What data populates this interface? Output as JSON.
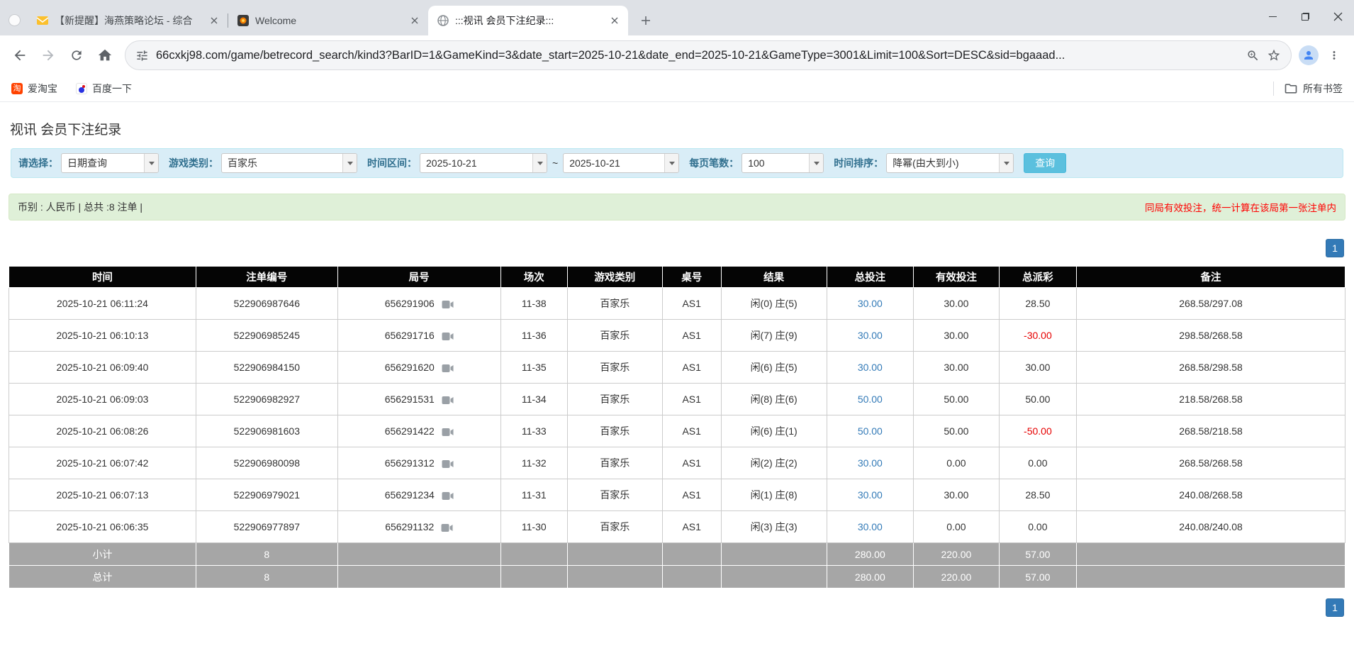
{
  "colors": {
    "table_header_bg": "#000000",
    "link_blue": "#337ab7",
    "negative_red": "#e60000",
    "result_red": "#e60000",
    "filter_bar_bg": "#d9edf7",
    "summary_bar_bg": "#dff0d8",
    "search_button_bg": "#5bc0de",
    "pagination_bg": "#337ab7",
    "footer_row_bg": "#a6a6a6"
  },
  "browser": {
    "tabs": [
      {
        "title": "【新提醒】海燕策略论坛 - 综合"
      },
      {
        "title": "Welcome"
      },
      {
        "title": ":::视讯 会员下注纪录:::"
      }
    ],
    "url": "66cxkj98.com/game/betrecord_search/kind3?BarID=1&GameKind=3&date_start=2025-10-21&date_end=2025-10-21&GameType=3001&Limit=100&Sort=DESC&sid=bgaaad...",
    "bookmarks": {
      "taobao": "爱淘宝",
      "taobao_icon_glyph": "淘",
      "baidu": "百度一下",
      "all_bookmarks": "所有书签"
    }
  },
  "page": {
    "title": "视讯 会员下注纪录",
    "filters": {
      "select_label": "请选择：",
      "select_value": "日期查询",
      "game_label": "游戏类别：",
      "game_value": "百家乐",
      "range_label": "时间区间：",
      "date_start": "2025-10-21",
      "tilde": "~",
      "date_end": "2025-10-21",
      "per_page_label": "每页笔数：",
      "per_page_value": "100",
      "sort_label": "时间排序：",
      "sort_value": "降幂(由大到小)",
      "search_button": "查询"
    },
    "summary": {
      "left": "币别 : 人民币 | 总共 :8 注单 |",
      "note": "同局有效投注，统一计算在该局第一张注单内"
    },
    "pagination": {
      "page": "1"
    },
    "table": {
      "headers": [
        "时间",
        "注单编号",
        "局号",
        "场次",
        "游戏类别",
        "桌号",
        "结果",
        "总投注",
        "有效投注",
        "总派彩",
        "备注"
      ],
      "rows": [
        {
          "time": "2025-10-21 06:11:24",
          "bet_id": "522906987646",
          "round": "656291906",
          "session": "11-38",
          "game": "百家乐",
          "table_no": "AS1",
          "result": "闲(0) 庄(5)",
          "total_bet": "30.00",
          "valid_bet": "30.00",
          "payout": "28.50",
          "note": "268.58/297.08"
        },
        {
          "time": "2025-10-21 06:10:13",
          "bet_id": "522906985245",
          "round": "656291716",
          "session": "11-36",
          "game": "百家乐",
          "table_no": "AS1",
          "result": "闲(7) 庄(9)",
          "total_bet": "30.00",
          "valid_bet": "30.00",
          "payout": "-30.00",
          "note": "298.58/268.58"
        },
        {
          "time": "2025-10-21 06:09:40",
          "bet_id": "522906984150",
          "round": "656291620",
          "session": "11-35",
          "game": "百家乐",
          "table_no": "AS1",
          "result": "闲(6) 庄(5)",
          "total_bet": "30.00",
          "valid_bet": "30.00",
          "payout": "30.00",
          "note": "268.58/298.58"
        },
        {
          "time": "2025-10-21 06:09:03",
          "bet_id": "522906982927",
          "round": "656291531",
          "session": "11-34",
          "game": "百家乐",
          "table_no": "AS1",
          "result": "闲(8) 庄(6)",
          "total_bet": "50.00",
          "valid_bet": "50.00",
          "payout": "50.00",
          "note": "218.58/268.58"
        },
        {
          "time": "2025-10-21 06:08:26",
          "bet_id": "522906981603",
          "round": "656291422",
          "session": "11-33",
          "game": "百家乐",
          "table_no": "AS1",
          "result": "闲(6) 庄(1)",
          "total_bet": "50.00",
          "valid_bet": "50.00",
          "payout": "-50.00",
          "note": "268.58/218.58"
        },
        {
          "time": "2025-10-21 06:07:42",
          "bet_id": "522906980098",
          "round": "656291312",
          "session": "11-32",
          "game": "百家乐",
          "table_no": "AS1",
          "result": "闲(2) 庄(2)",
          "total_bet": "30.00",
          "valid_bet": "0.00",
          "payout": "0.00",
          "note": "268.58/268.58"
        },
        {
          "time": "2025-10-21 06:07:13",
          "bet_id": "522906979021",
          "round": "656291234",
          "session": "11-31",
          "game": "百家乐",
          "table_no": "AS1",
          "result": "闲(1) 庄(8)",
          "total_bet": "30.00",
          "valid_bet": "30.00",
          "payout": "28.50",
          "note": "240.08/268.58"
        },
        {
          "time": "2025-10-21 06:06:35",
          "bet_id": "522906977897",
          "round": "656291132",
          "session": "11-30",
          "game": "百家乐",
          "table_no": "AS1",
          "result": "闲(3) 庄(3)",
          "total_bet": "30.00",
          "valid_bet": "0.00",
          "payout": "0.00",
          "note": "240.08/240.08"
        }
      ],
      "subtotal": {
        "label": "小计",
        "count": "8",
        "total_bet": "280.00",
        "valid_bet": "220.00",
        "payout": "57.00"
      },
      "grand_total": {
        "label": "总计",
        "count": "8",
        "total_bet": "280.00",
        "valid_bet": "220.00",
        "payout": "57.00"
      }
    }
  }
}
